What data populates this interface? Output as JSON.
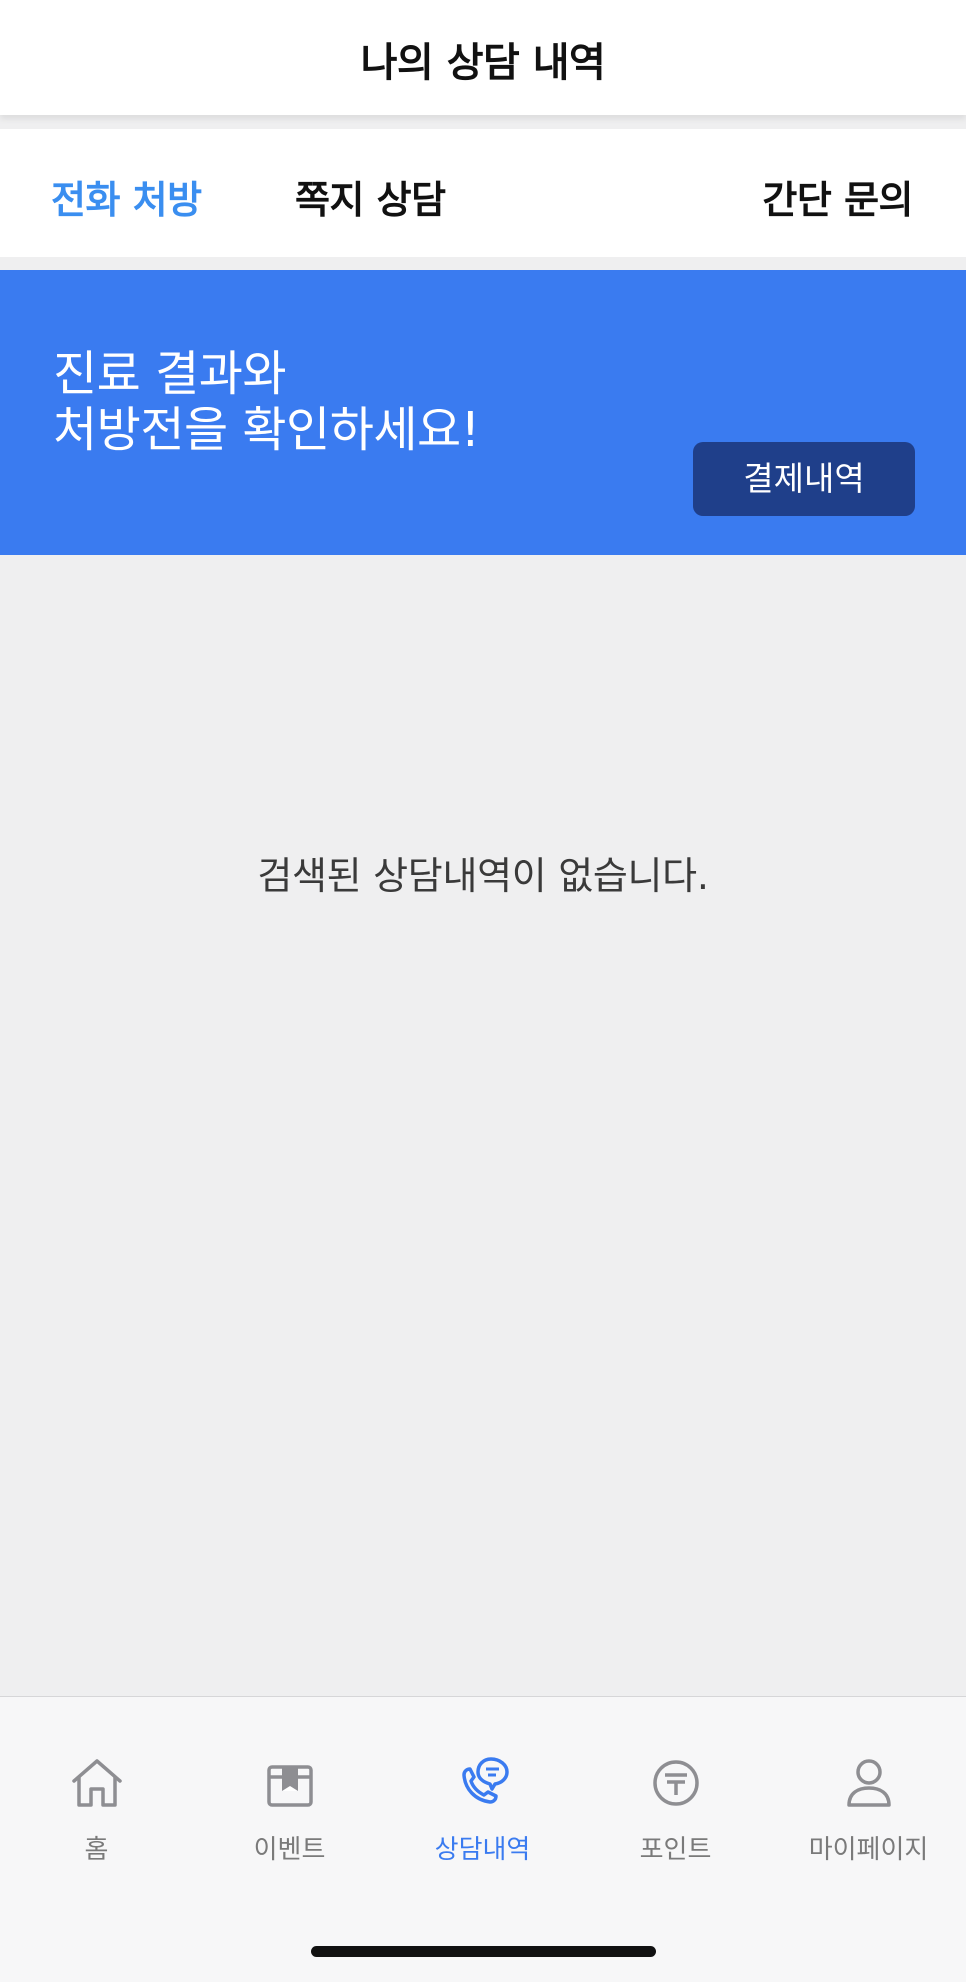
{
  "header": {
    "title": "나의 상담 내역"
  },
  "tabs": [
    {
      "label": "전화 처방",
      "active": true
    },
    {
      "label": "쪽지 상담",
      "active": false
    },
    {
      "label": "간단 문의",
      "active": false
    }
  ],
  "banner": {
    "line1": "진료 결과와",
    "line2": "처방전을 확인하세요!",
    "button_label": "결제내역",
    "background": "#3a7bf0",
    "button_color": "#1f3f8a"
  },
  "empty_message": "검색된 상담내역이 없습니다.",
  "bottom_nav": {
    "items": [
      {
        "label": "홈",
        "icon": "home-icon",
        "active": false
      },
      {
        "label": "이벤트",
        "icon": "gift-icon",
        "active": false
      },
      {
        "label": "상담내역",
        "icon": "phone-chat-icon",
        "active": true
      },
      {
        "label": "포인트",
        "icon": "point-coin-icon",
        "active": false
      },
      {
        "label": "마이페이지",
        "icon": "user-icon",
        "active": false
      }
    ]
  },
  "colors": {
    "accent": "#3a8ef0",
    "inactive": "#7a7a7a",
    "background": "#efeff0"
  }
}
